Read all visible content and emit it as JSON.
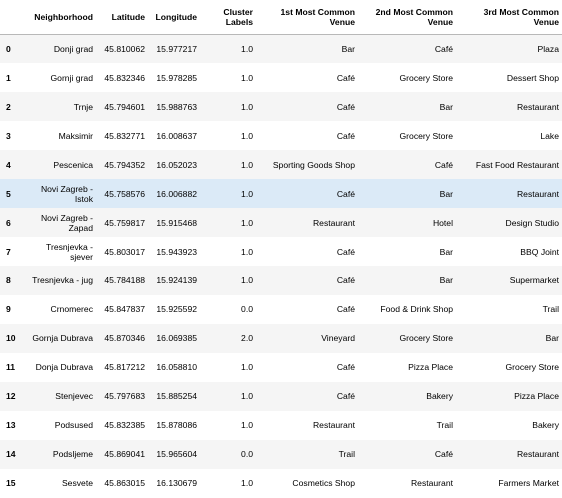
{
  "columns": [
    "",
    "Neighborhood",
    "Latitude",
    "Longitude",
    "Cluster Labels",
    "1st Most Common Venue",
    "2nd Most Common Venue",
    "3rd Most Common Venue"
  ],
  "rows": [
    {
      "index": "0",
      "neighborhood": "Donji grad",
      "lat": "45.810062",
      "lon": "15.977217",
      "cluster": "1.0",
      "v1": "Bar",
      "v2": "Café",
      "v3": "Plaza"
    },
    {
      "index": "1",
      "neighborhood": "Gornji grad",
      "lat": "45.832346",
      "lon": "15.978285",
      "cluster": "1.0",
      "v1": "Café",
      "v2": "Grocery Store",
      "v3": "Dessert Shop"
    },
    {
      "index": "2",
      "neighborhood": "Trnje",
      "lat": "45.794601",
      "lon": "15.988763",
      "cluster": "1.0",
      "v1": "Café",
      "v2": "Bar",
      "v3": "Restaurant"
    },
    {
      "index": "3",
      "neighborhood": "Maksimir",
      "lat": "45.832771",
      "lon": "16.008637",
      "cluster": "1.0",
      "v1": "Café",
      "v2": "Grocery Store",
      "v3": "Lake"
    },
    {
      "index": "4",
      "neighborhood": "Pescenica",
      "lat": "45.794352",
      "lon": "16.052023",
      "cluster": "1.0",
      "v1": "Sporting Goods Shop",
      "v2": "Café",
      "v3": "Fast Food Restaurant"
    },
    {
      "index": "5",
      "neighborhood": "Novi Zagreb - Istok",
      "lat": "45.758576",
      "lon": "16.006882",
      "cluster": "1.0",
      "v1": "Café",
      "v2": "Bar",
      "v3": "Restaurant"
    },
    {
      "index": "6",
      "neighborhood": "Novi Zagreb - Zapad",
      "lat": "45.759817",
      "lon": "15.915468",
      "cluster": "1.0",
      "v1": "Restaurant",
      "v2": "Hotel",
      "v3": "Design Studio"
    },
    {
      "index": "7",
      "neighborhood": "Tresnjevka - sjever",
      "lat": "45.803017",
      "lon": "15.943923",
      "cluster": "1.0",
      "v1": "Café",
      "v2": "Bar",
      "v3": "BBQ Joint"
    },
    {
      "index": "8",
      "neighborhood": "Tresnjevka - jug",
      "lat": "45.784188",
      "lon": "15.924139",
      "cluster": "1.0",
      "v1": "Café",
      "v2": "Bar",
      "v3": "Supermarket"
    },
    {
      "index": "9",
      "neighborhood": "Crnomerec",
      "lat": "45.847837",
      "lon": "15.925592",
      "cluster": "0.0",
      "v1": "Café",
      "v2": "Food & Drink Shop",
      "v3": "Trail"
    },
    {
      "index": "10",
      "neighborhood": "Gornja Dubrava",
      "lat": "45.870346",
      "lon": "16.069385",
      "cluster": "2.0",
      "v1": "Vineyard",
      "v2": "Grocery Store",
      "v3": "Bar"
    },
    {
      "index": "11",
      "neighborhood": "Donja Dubrava",
      "lat": "45.817212",
      "lon": "16.058810",
      "cluster": "1.0",
      "v1": "Café",
      "v2": "Pizza Place",
      "v3": "Grocery Store"
    },
    {
      "index": "12",
      "neighborhood": "Stenjevec",
      "lat": "45.797683",
      "lon": "15.885254",
      "cluster": "1.0",
      "v1": "Café",
      "v2": "Bakery",
      "v3": "Pizza Place"
    },
    {
      "index": "13",
      "neighborhood": "Podsused",
      "lat": "45.832385",
      "lon": "15.878086",
      "cluster": "1.0",
      "v1": "Restaurant",
      "v2": "Trail",
      "v3": "Bakery"
    },
    {
      "index": "14",
      "neighborhood": "Podsljeme",
      "lat": "45.869041",
      "lon": "15.965604",
      "cluster": "0.0",
      "v1": "Trail",
      "v2": "Café",
      "v3": "Restaurant"
    },
    {
      "index": "15",
      "neighborhood": "Sesvete",
      "lat": "45.863015",
      "lon": "16.130679",
      "cluster": "1.0",
      "v1": "Cosmetics Shop",
      "v2": "Restaurant",
      "v3": "Farmers Market"
    }
  ],
  "hovered_row": "5"
}
